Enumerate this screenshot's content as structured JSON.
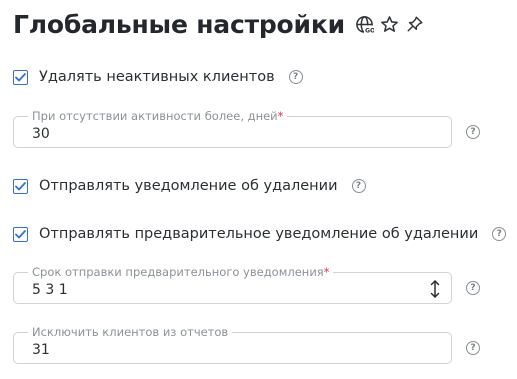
{
  "header": {
    "title": "Глобальные настройки",
    "icons": [
      "globe-icon",
      "star-icon",
      "pin-icon"
    ]
  },
  "settings": {
    "delete_inactive": {
      "label": "Удалять неактивных клиентов",
      "checked": true
    },
    "inactivity_days": {
      "label": "При отсутствии активности более, дней",
      "required_mark": "*",
      "value": "30"
    },
    "notify_deletion": {
      "label": "Отправлять уведомление об удалении",
      "checked": true
    },
    "pre_notify_deletion": {
      "label": "Отправлять предварительное уведомление об удалении",
      "checked": true
    },
    "pre_notify_period": {
      "label": "Срок отправки предварительного уведомления",
      "required_mark": "*",
      "value": "5 3 1"
    },
    "exclude_from_reports": {
      "label": "Исключить клиентов из отчетов",
      "value": "31"
    }
  },
  "help_glyph": "?",
  "colors": {
    "accent": "#3a6fc9",
    "required": "#d8334a",
    "border": "#cfd3d7",
    "label": "#8c9196"
  }
}
